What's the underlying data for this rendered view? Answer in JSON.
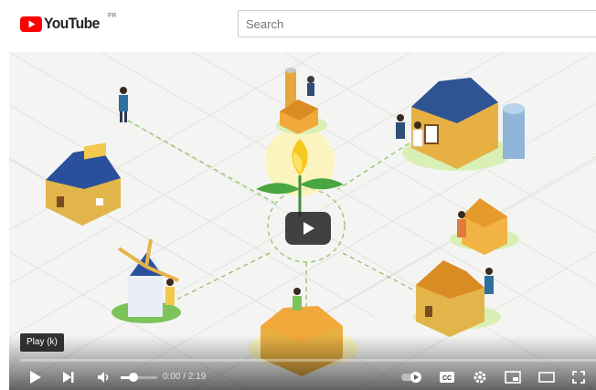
{
  "masthead": {
    "logo_text": "YouTube",
    "country_code": "FR",
    "search_placeholder": "Search"
  },
  "player": {
    "tooltip": "Play (k)",
    "current_time": "0:00",
    "time_separator": " / ",
    "duration": "2:19",
    "progress_fraction": 0.0,
    "volume_fraction": 0.35
  },
  "colors": {
    "youtube_red": "#ff0000",
    "text_dark": "#212121",
    "player_overlay": "#1c1c1c"
  },
  "icons": [
    "youtube-logo-icon",
    "big-play-icon",
    "play-icon",
    "next-icon",
    "volume-icon",
    "autoplay-toggle-icon",
    "subtitles-icon",
    "settings-icon",
    "miniplayer-icon",
    "theater-mode-icon",
    "fullscreen-icon"
  ]
}
